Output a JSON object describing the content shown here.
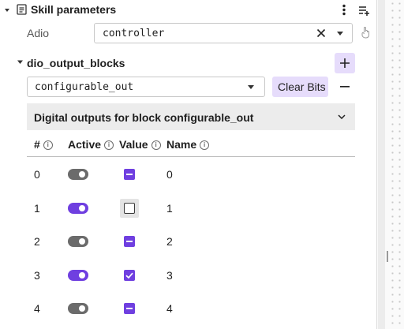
{
  "header": {
    "title": "Skill parameters"
  },
  "adio": {
    "label": "Adio",
    "value": "controller"
  },
  "blocks": {
    "title": "dio_output_blocks",
    "selected": "configurable_out",
    "clear_label": "Clear Bits"
  },
  "panel": {
    "title": "Digital outputs for block configurable_out"
  },
  "table": {
    "headers": {
      "index": "#",
      "active": "Active",
      "value": "Value",
      "name": "Name"
    },
    "rows": [
      {
        "index": "0",
        "active": false,
        "value": "indeterminate",
        "name": "0"
      },
      {
        "index": "1",
        "active": true,
        "value": "unchecked",
        "name": "1"
      },
      {
        "index": "2",
        "active": false,
        "value": "indeterminate",
        "name": "2"
      },
      {
        "index": "3",
        "active": true,
        "value": "checked",
        "name": "3"
      },
      {
        "index": "4",
        "active": false,
        "value": "indeterminate",
        "name": "4"
      }
    ]
  },
  "colors": {
    "accent": "#6f3fe0",
    "accent_soft": "#e6dcfb",
    "panel_bg": "#ececec"
  },
  "icons": {
    "collapse": "caret-down-icon",
    "document": "document-icon",
    "menu": "more-vertical-icon",
    "add_list": "playlist-add-icon",
    "clear": "close-icon",
    "dropdown": "caret-down-icon",
    "hand": "hand-pointer-icon",
    "add": "plus-icon",
    "remove": "minus-icon",
    "expand": "chevron-down-icon",
    "info": "info-icon"
  }
}
